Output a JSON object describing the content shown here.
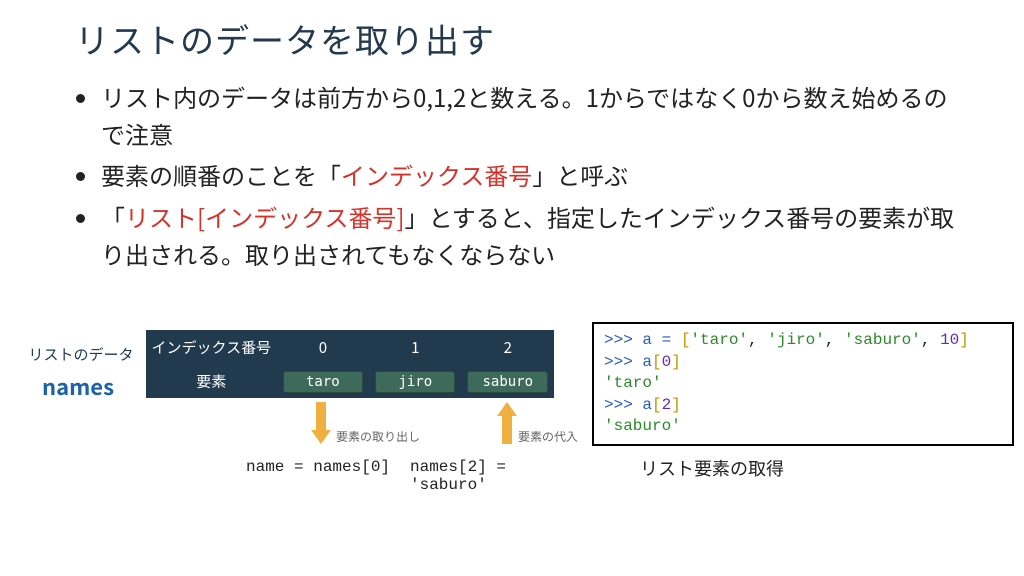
{
  "title": "リストのデータを取り出す",
  "bullets": {
    "b1_a": "リスト内のデータは前方から0,1,2と数える。1からではなく0から数え始めるので注意",
    "b2_pre": "要素の順番のことを「",
    "b2_red": "インデックス番号",
    "b2_post": "」と呼ぶ",
    "b3_quote_open": "「",
    "b3_red": "リスト[インデックス番号]",
    "b3_post": "」とすると、指定したインデックス番号の要素が取り出される。取り出されてもなくならない"
  },
  "diagram": {
    "data_label": "リストのデータ",
    "names_label": "names",
    "header_index": "インデックス番号",
    "header_elem": "要素",
    "indices": [
      "0",
      "1",
      "2"
    ],
    "elements": [
      "taro",
      "jiro",
      "saburo"
    ],
    "arrow_out_label": "要素の取り出し",
    "arrow_in_label": "要素の代入",
    "code_out": "name = names[0]",
    "code_in": "names[2] = 'saburo'"
  },
  "codebox": {
    "line1_a": ">>> a = ",
    "line1_b": "[",
    "line1_c": "'taro'",
    "line1_d": ", ",
    "line1_e": "'jiro'",
    "line1_f": ", ",
    "line1_g": "'saburo'",
    "line1_h": ", ",
    "line1_i": "10",
    "line1_j": "]",
    "line2_a": ">>> a",
    "line2_b": "[",
    "line2_c": "0",
    "line2_d": "]",
    "line3": "'taro'",
    "line4_a": ">>> a",
    "line4_b": "[",
    "line4_c": "2",
    "line4_d": "]",
    "line5": "'saburo'",
    "caption": "リスト要素の取得"
  }
}
